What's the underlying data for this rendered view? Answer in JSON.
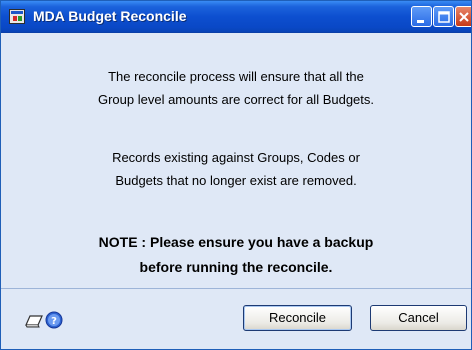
{
  "window": {
    "title": "MDA Budget Reconcile"
  },
  "message": {
    "line1": "The reconcile process will ensure that all the",
    "line2": "Group level amounts are correct for all Budgets.",
    "line3": "Records existing against Groups, Codes or",
    "line4": "Budgets that no longer exist are removed."
  },
  "note": {
    "line1": "NOTE : Please ensure you have a backup",
    "line2": "before running the reconcile."
  },
  "buttons": {
    "reconcile_label": "Reconcile",
    "cancel_label": "Cancel"
  },
  "icons": {
    "app": "app-window-icon",
    "minimize": "minimize-icon",
    "maximize": "maximize-icon",
    "close": "close-icon",
    "note": "note-icon",
    "help": "help-icon"
  },
  "colors": {
    "titlebar": "#0d4fd0",
    "dialog_background": "#dfe8f6",
    "close_button": "#c83a17"
  }
}
